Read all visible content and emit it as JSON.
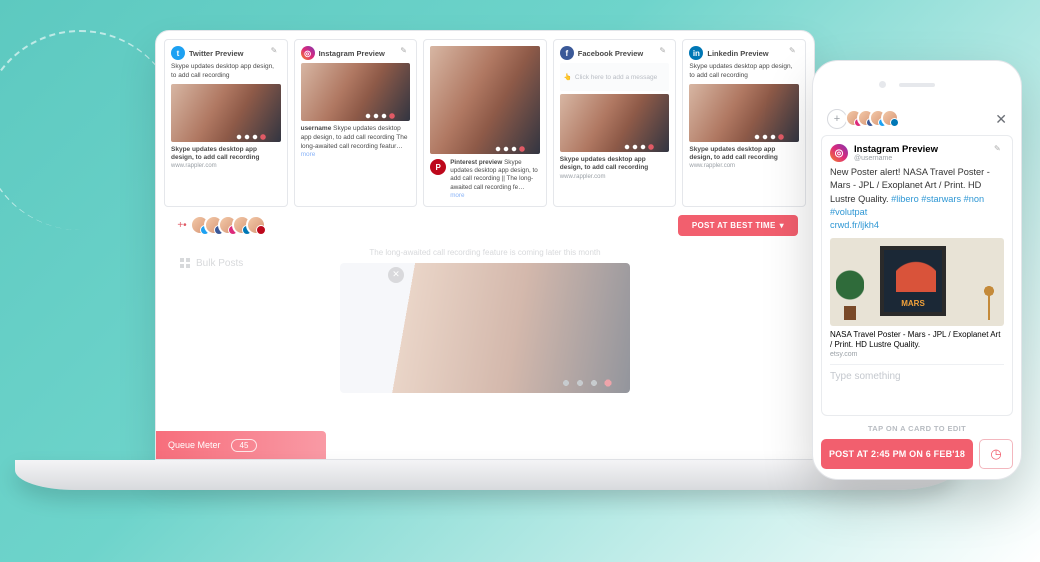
{
  "laptop": {
    "cards": {
      "twitter": {
        "title": "Twitter Preview",
        "desc": "Skype updates desktop app design, to add call recording",
        "caption": "Skype updates desktop app design, to add call recording",
        "url": "www.rappler.com"
      },
      "instagram": {
        "title": "Instagram Preview",
        "username": "username",
        "caption": "Skype updates desktop app design, to add call recording The long-awaited call recording featur…",
        "more": "more"
      },
      "facebook": {
        "title": "Facebook Preview",
        "hint": "Click here to add a message",
        "caption": "Skype updates desktop app design, to add call recording",
        "url": "www.rappler.com"
      },
      "pinterest": {
        "title": "Pinterest preview",
        "text": "Skype updates desktop app design, to add call recording || The long-awaited call recording fe…",
        "more": "more"
      },
      "linkedin": {
        "title": "Linkedin Preview",
        "desc": "Skype updates desktop app design, to add call recording",
        "caption": "Skype updates desktop app design, to add call recording",
        "url": "www.rappler.com"
      }
    },
    "post_button": "POST AT BEST TIME",
    "bulk_label": "Bulk Posts",
    "editor_hint": "The long-awaited call recording feature is coming later this month",
    "queue_label": "Queue Meter",
    "queue_count": "45"
  },
  "phone": {
    "card_title": "Instagram Preview",
    "handle": "@username",
    "body_plain": "New Poster alert! NASA Travel Poster - Mars - JPL / Exoplanet Art  / Print. HD Lustre Quality. ",
    "hashtags": "#libero #starwars #non #volutpat",
    "shortlink": "crwd.fr/ljkh4",
    "caption": "NASA Travel Poster - Mars - JPL / Exoplanet Art  / Print. HD Lustre Quality.",
    "url": "etsy.com",
    "input_placeholder": "Type something",
    "tap_hint": "TAP ON A CARD TO EDIT",
    "post_button": "POST AT 2:45 PM ON 6 FEB'18"
  },
  "colors": {
    "accent": "#f25f6e",
    "link": "#2e97d4"
  }
}
